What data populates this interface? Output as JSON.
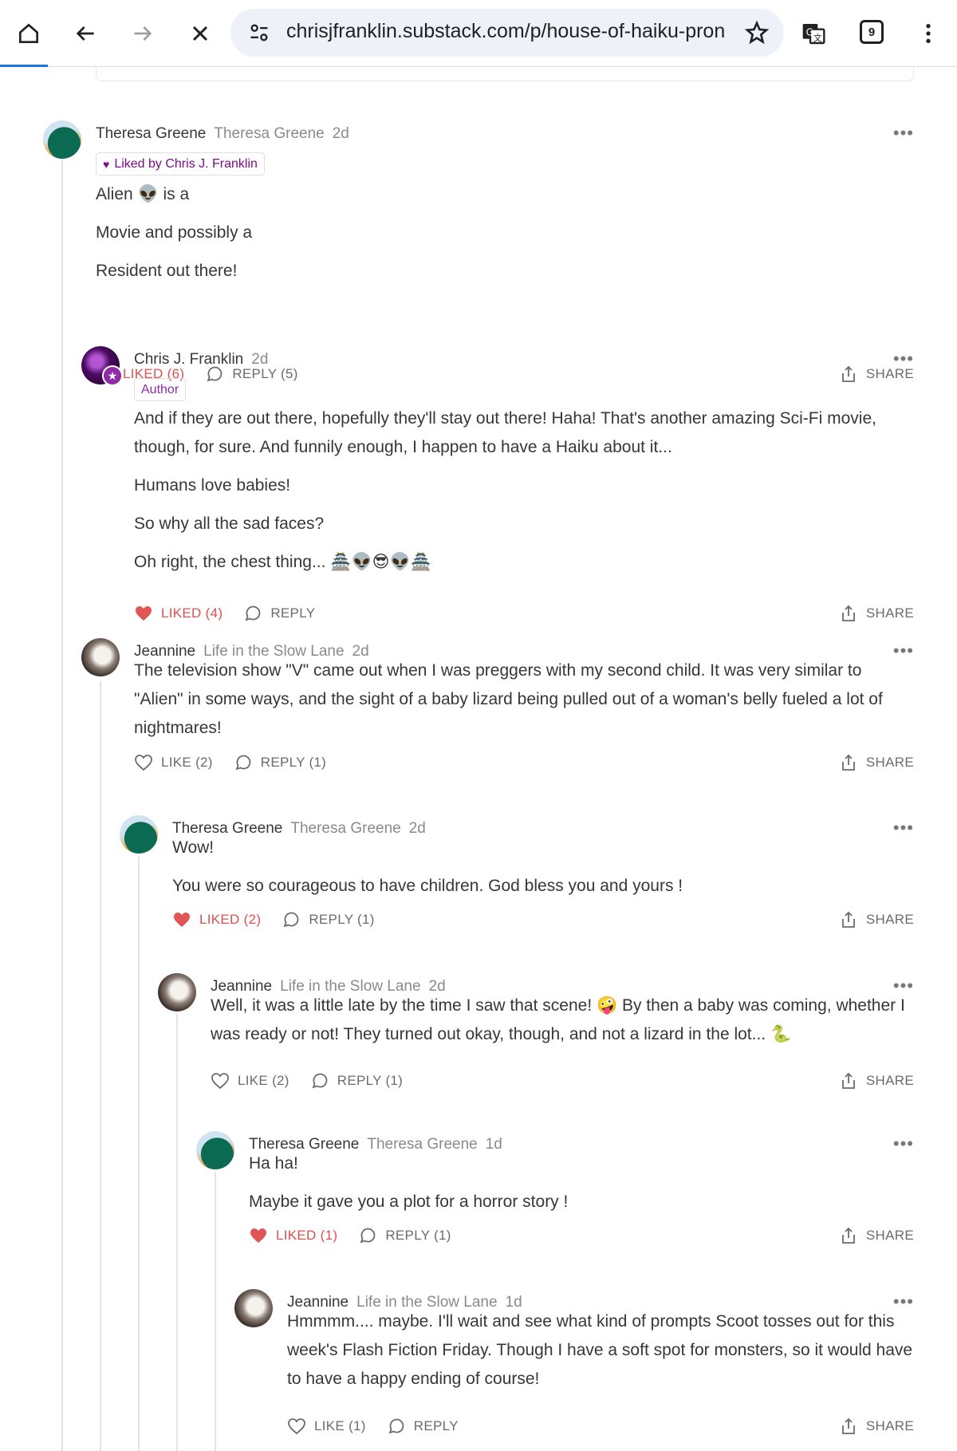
{
  "browser": {
    "url": "chrisjfranklin.substack.com/p/house-of-haiku-pron",
    "tab_count": "9"
  },
  "actions": {
    "share": "SHARE"
  },
  "comments": [
    {
      "name": "Theresa Greene",
      "publication": "Theresa Greene",
      "time": "2d",
      "tag": "Liked by Chris J. Franklin",
      "paragraphs": [
        "Alien 👽 is a",
        "Movie and possibly a",
        "Resident out there!"
      ],
      "like": "LIKED (6)",
      "reply": "REPLY (5)"
    },
    {
      "name": "Chris J. Franklin",
      "publication": "",
      "time": "2d",
      "tag": "Author",
      "paragraphs": [
        "And if they are out there, hopefully they'll stay out there! Haha! That's another amazing Sci-Fi movie, though, for sure. And funnily enough, I happen to have a Haiku about it...",
        "Humans love babies!",
        "So why all the sad faces?",
        "Oh right, the chest thing... 🏯👽😎👽🏯"
      ],
      "like": "LIKED (4)",
      "reply": "REPLY"
    },
    {
      "name": "Jeannine",
      "publication": "Life in the Slow Lane",
      "time": "2d",
      "paragraphs": [
        "The television show \"V\" came out when I was preggers with my second child. It was very similar to \"Alien\" in some ways, and the sight of a baby lizard being pulled out of a woman's belly fueled a lot of nightmares!"
      ],
      "like": "LIKE (2)",
      "reply": "REPLY (1)"
    },
    {
      "name": "Theresa Greene",
      "publication": "Theresa Greene",
      "time": "2d",
      "paragraphs": [
        "Wow!",
        "You were so courageous to have children. God bless you and yours !"
      ],
      "like": "LIKED (2)",
      "reply": "REPLY (1)"
    },
    {
      "name": "Jeannine",
      "publication": "Life in the Slow Lane",
      "time": "2d",
      "paragraphs": [
        "Well, it was a little late by the time I saw that scene! 🤪 By then a baby was coming, whether I was ready or not! They turned out okay, though, and not a lizard in the lot... 🐍"
      ],
      "like": "LIKE (2)",
      "reply": "REPLY (1)"
    },
    {
      "name": "Theresa Greene",
      "publication": "Theresa Greene",
      "time": "1d",
      "paragraphs": [
        "Ha ha!",
        "Maybe it gave you a plot for a horror story !"
      ],
      "like": "LIKED (1)",
      "reply": "REPLY (1)"
    },
    {
      "name": "Jeannine",
      "publication": "Life in the Slow Lane",
      "time": "1d",
      "paragraphs": [
        "Hmmmm.... maybe. I'll wait and see what kind of prompts Scoot tosses out for this week's Flash Fiction Friday. Though I have a soft spot for monsters, so it would have to have a happy ending of course!"
      ],
      "like": "LIKE (1)",
      "reply": "REPLY"
    }
  ],
  "colors": {
    "liked": "#d9534f",
    "accent": "#8d2ca6",
    "link": "#1a73e8"
  },
  "icons": [
    "home-icon",
    "back-icon",
    "forward-icon",
    "close-icon",
    "site-settings-icon",
    "star-icon",
    "translate-icon",
    "tabs-icon",
    "menu-icon",
    "heart-icon",
    "comment-icon",
    "share-icon",
    "more-icon"
  ]
}
